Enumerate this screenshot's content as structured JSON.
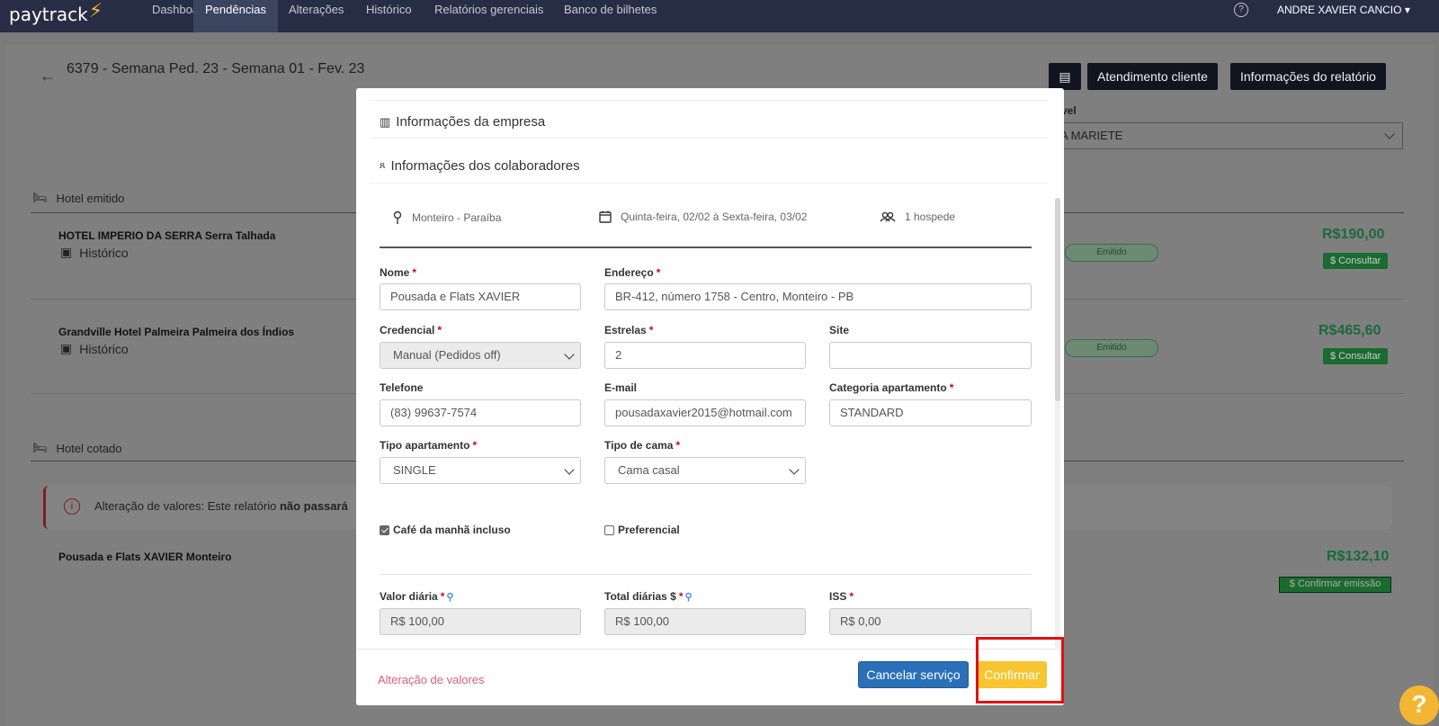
{
  "nav": {
    "logo": "paytrack",
    "items": [
      "Dashboard",
      "Pendências",
      "Alterações",
      "Histórico",
      "Relatórios gerenciais",
      "Banco de bilhetes"
    ],
    "active_index": 1,
    "help_icon": "?",
    "user": "ANDRE XAVIER CANCIO"
  },
  "report": {
    "title": "6379 - Semana Ped. 23 - Semana 01 - Fev. 23",
    "buttons": [
      "Atendimento cliente",
      "Informações do relatório"
    ],
    "responsible_label": "vel",
    "responsible_value": "A MARIETE"
  },
  "sections": {
    "emitted_title": "Hotel emitido",
    "quoted_title": "Hotel cotado"
  },
  "hotels": [
    {
      "name": "HOTEL IMPERIO DA SERRA Serra Talhada",
      "history": "Histórico",
      "status": "Emitido",
      "price": "R$190,00",
      "action": "$ Consultar"
    },
    {
      "name": "Grandville Hotel Palmeira Palmeira dos Índios",
      "history": "Histórico",
      "status": "Emitido",
      "price": "R$465,60",
      "action": "$ Consultar"
    }
  ],
  "alert": {
    "text": "Alteração de valores: Este relatório ",
    "bold": "não passará"
  },
  "quoted": {
    "name": "Pousada e Flats XAVIER Monteiro",
    "price": "R$132,10",
    "action": "$ Confirmar emissão"
  },
  "modal": {
    "company_info": "Informações da empresa",
    "collaborators_info": "Informações dos colaboradores",
    "location": "Monteiro - Paraíba",
    "dates": "Quinta-feira, 02/02 à Sexta-feira, 03/02",
    "guests": "1 hospede",
    "fields": {
      "nome": {
        "label": "Nome",
        "value": "Pousada e Flats XAVIER"
      },
      "endereco": {
        "label": "Endereço",
        "value": "BR-412, número 1758 - Centro, Monteiro - PB"
      },
      "credencial": {
        "label": "Credencial",
        "value": "Manual (Pedidos off)"
      },
      "estrelas": {
        "label": "Estrelas",
        "value": "2"
      },
      "site": {
        "label": "Site",
        "value": ""
      },
      "telefone": {
        "label": "Telefone",
        "value": "(83) 99637-7574"
      },
      "email": {
        "label": "E-mail",
        "value": "pousadaxavier2015@hotmail.com"
      },
      "categoria": {
        "label": "Categoria apartamento",
        "value": "STANDARD"
      },
      "tipo_apto": {
        "label": "Tipo apartamento",
        "value": "SINGLE"
      },
      "tipo_cama": {
        "label": "Tipo de cama",
        "value": "Cama casal"
      },
      "valor_diaria": {
        "label": "Valor diária",
        "value": "R$ 100,00"
      },
      "total_diarias": {
        "label": "Total diárias $",
        "value": "R$ 100,00"
      },
      "iss": {
        "label": "ISS",
        "value": "R$ 0,00"
      }
    },
    "cafe": {
      "label": "Café da manhã incluso",
      "checked": true
    },
    "preferencial": {
      "label": "Preferencial",
      "checked": false
    },
    "footer": {
      "alter_link": "Alteração de valores",
      "cancel": "Cancelar serviço",
      "confirm": "Confirmar"
    }
  },
  "colors": {
    "nav_bg": "#272d44",
    "accent_yellow": "#f7c530",
    "primary_blue": "#2a6fb7",
    "required_red": "#d0021b",
    "highlight_red": "#e01010"
  }
}
